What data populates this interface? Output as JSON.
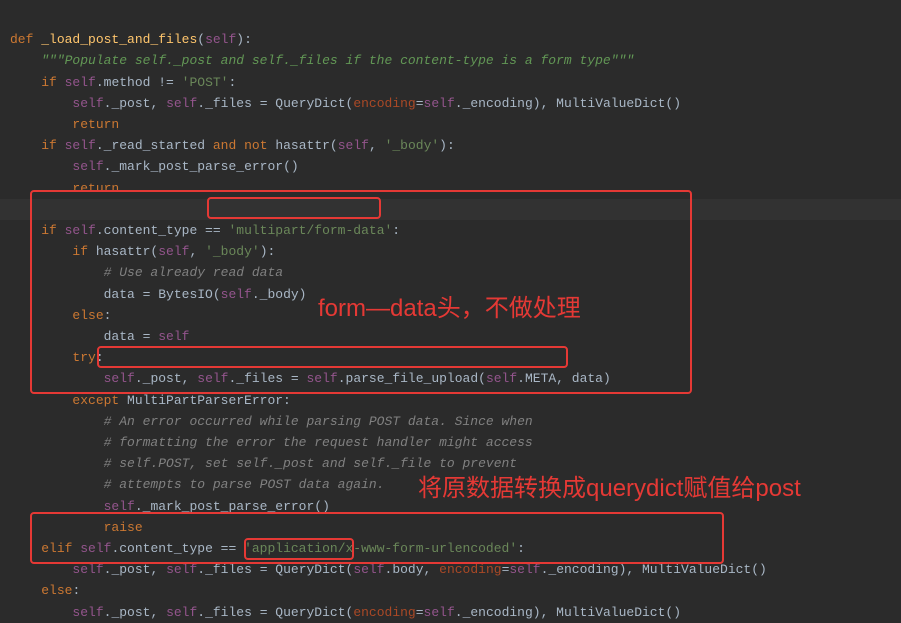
{
  "code": {
    "l1_def": "def ",
    "l1_fn": "_load_post_and_files",
    "l1_paren_open": "(",
    "l1_self": "self",
    "l1_close": "):",
    "l2_doc": "\"\"\"Populate self._post and self._files if the content-type is a form type\"\"\"",
    "l3_if": "if ",
    "l3_self": "self",
    "l3_method": ".method != ",
    "l3_str": "'POST'",
    "l3_colon": ":",
    "l4_self1": "self",
    "l4_post": "._post, ",
    "l4_self2": "self",
    "l4_files": "._files = QueryDict(",
    "l4_enc": "encoding",
    "l4_eq": "=",
    "l4_self3": "self",
    "l4_dotenc": "._encoding), MultiValueDict()",
    "l5_return": "return",
    "l6_if": "if ",
    "l6_self": "self",
    "l6_rs": "._read_started ",
    "l6_and": "and ",
    "l6_not": "not ",
    "l6_hasattr": "hasattr(",
    "l6_self2": "self",
    "l6_comma": ", ",
    "l6_str": "'_body'",
    "l6_close": "):",
    "l7_self": "self",
    "l7_call": "._mark_post_parse_error()",
    "l8_return": "return",
    "l9_blank": "",
    "l10_if": "if ",
    "l10_self": "self",
    "l10_ct": ".content_type == ",
    "l10_str": "'multipart/form-data'",
    "l10_colon": ":",
    "l11_if": "if ",
    "l11_hasattr": "hasattr(",
    "l11_self": "self",
    "l11_comma": ", ",
    "l11_str": "'_body'",
    "l11_close": "):",
    "l12_cmt": "# Use already read data",
    "l13_txt": "data = BytesIO(",
    "l13_self": "self",
    "l13_body": "._body)",
    "l14_else": "else",
    "l14_colon": ":",
    "l15_data": "data = ",
    "l15_self": "self",
    "l16_try": "try",
    "l16_colon": ":",
    "l17_self1": "self",
    "l17_post": "._post, ",
    "l17_self2": "self",
    "l17_files": "._files = ",
    "l17_self3": "self",
    "l17_parse": ".parse_file_upload(",
    "l17_self4": "self",
    "l17_meta": ".META, data)",
    "l18_except": "except ",
    "l18_err": "MultiPartParserError:",
    "l19_cmt": "# An error occurred while parsing POST data. Since when",
    "l20_cmt": "# formatting the error the request handler might access",
    "l21_cmt": "# self.POST, set self._post and self._file to prevent",
    "l22_cmt": "# attempts to parse POST data again.",
    "l23_self": "self",
    "l23_call": "._mark_post_parse_error()",
    "l24_raise": "raise",
    "l25_elif": "elif ",
    "l25_self": "self",
    "l25_ct": ".content_type == ",
    "l25_str": "'application/x-www-form-urlencoded'",
    "l25_colon": ":",
    "l26_self1": "self",
    "l26_post": "._post, ",
    "l26_self2": "self",
    "l26_files": "._files = QueryDict(",
    "l26_self3": "self",
    "l26_body": ".body, ",
    "l26_enc": "encoding",
    "l26_eq": "=",
    "l26_self4": "self",
    "l26_dotenc": "._encoding), MultiValueDict()",
    "l27_else": "else",
    "l27_colon": ":",
    "l28_self1": "self",
    "l28_post": "._post, ",
    "l28_self2": "self",
    "l28_files": "._files = QueryDict(",
    "l28_enc": "encoding",
    "l28_eq": "=",
    "l28_self3": "self",
    "l28_dotenc": "._encoding), MultiValueDict()"
  },
  "annotations": {
    "a1": "form—data头，不做处理",
    "a2": "将原数据转换成querydict赋值给post"
  }
}
